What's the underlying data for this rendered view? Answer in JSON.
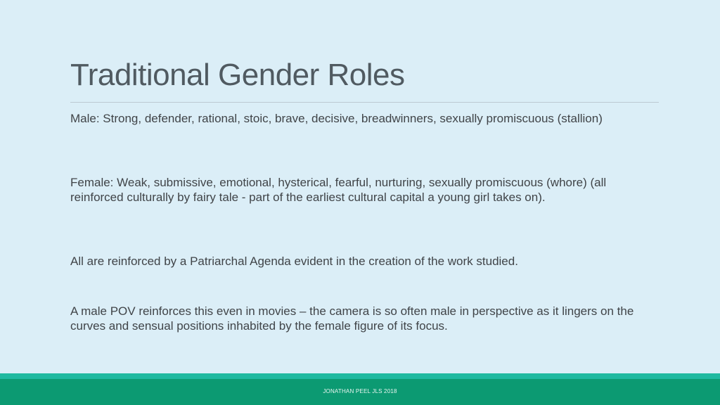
{
  "slide": {
    "title": "Traditional Gender Roles",
    "paragraphs": [
      "Male: Strong, defender, rational, stoic, brave, decisive, breadwinners, sexually promiscuous (stallion)",
      "Female: Weak, submissive, emotional, hysterical, fearful, nurturing, sexually promiscuous (whore) (all reinforced culturally by fairy tale  - part of the earliest cultural capital a young girl takes on).",
      "All are reinforced by a Patriarchal Agenda evident in the creation of the work studied.",
      "A male POV reinforces this even in movies – the camera is so often male in perspective as it lingers on the curves and sensual positions inhabited by the female figure of its focus."
    ],
    "footer": "JONATHAN PEEL JLS 2018"
  },
  "colors": {
    "background": "#dbeef7",
    "title": "#505a61",
    "body_text": "#404448",
    "footer_stripe": "#1fb9a0",
    "footer_bar": "#0c9a72"
  }
}
